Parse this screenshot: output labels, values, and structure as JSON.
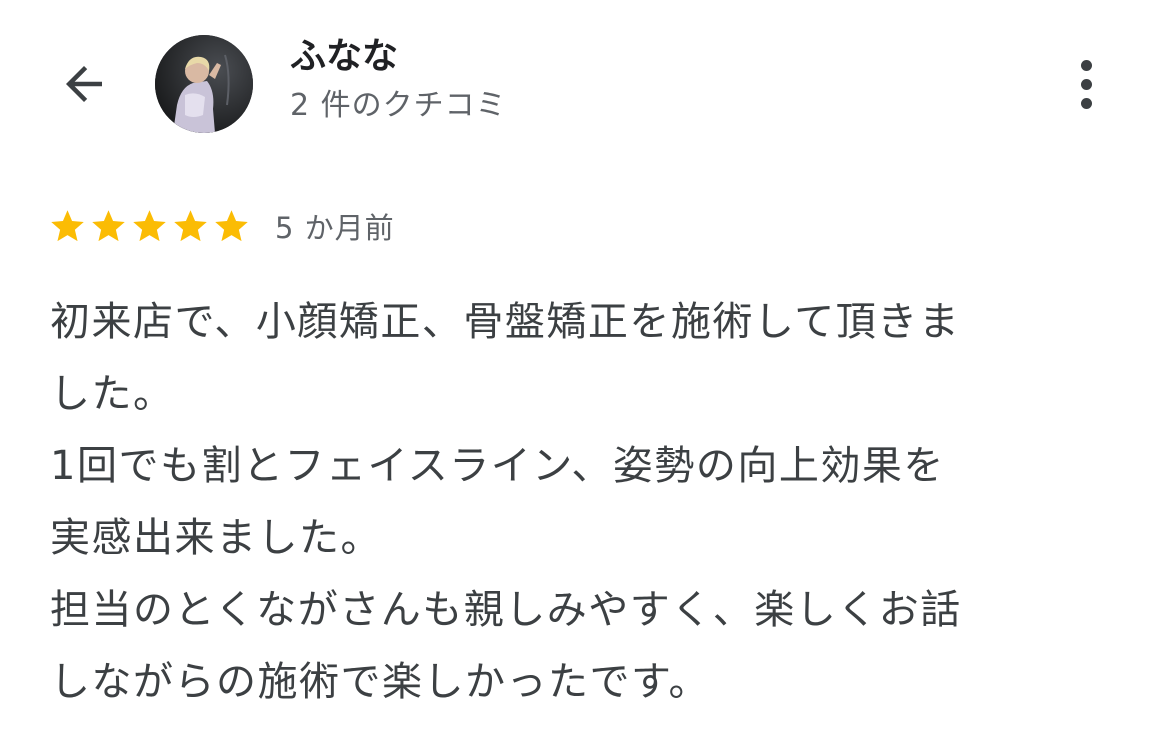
{
  "header": {
    "reviewer_name": "ふなな",
    "review_count": "2 件のクチコミ"
  },
  "review": {
    "rating": 5,
    "rating_max": 5,
    "date": "5 か月前",
    "lines": [
      "初来店で、小顔矯正、骨盤矯正を施術して頂きま",
      "した。",
      "1回でも割とフェイスライン、姿勢の向上効果を",
      "実感出来ました。",
      "担当のとくながさんも親しみやすく、楽しくお話",
      "しながらの施術で楽しかったです。"
    ]
  },
  "icons": {
    "back": "arrow-back-icon",
    "more": "more-vert-icon",
    "star": "star-icon"
  },
  "colors": {
    "star": "#fbbc04",
    "text_primary": "#202124",
    "text_secondary": "#5f6368",
    "body_text": "#3c4043"
  }
}
